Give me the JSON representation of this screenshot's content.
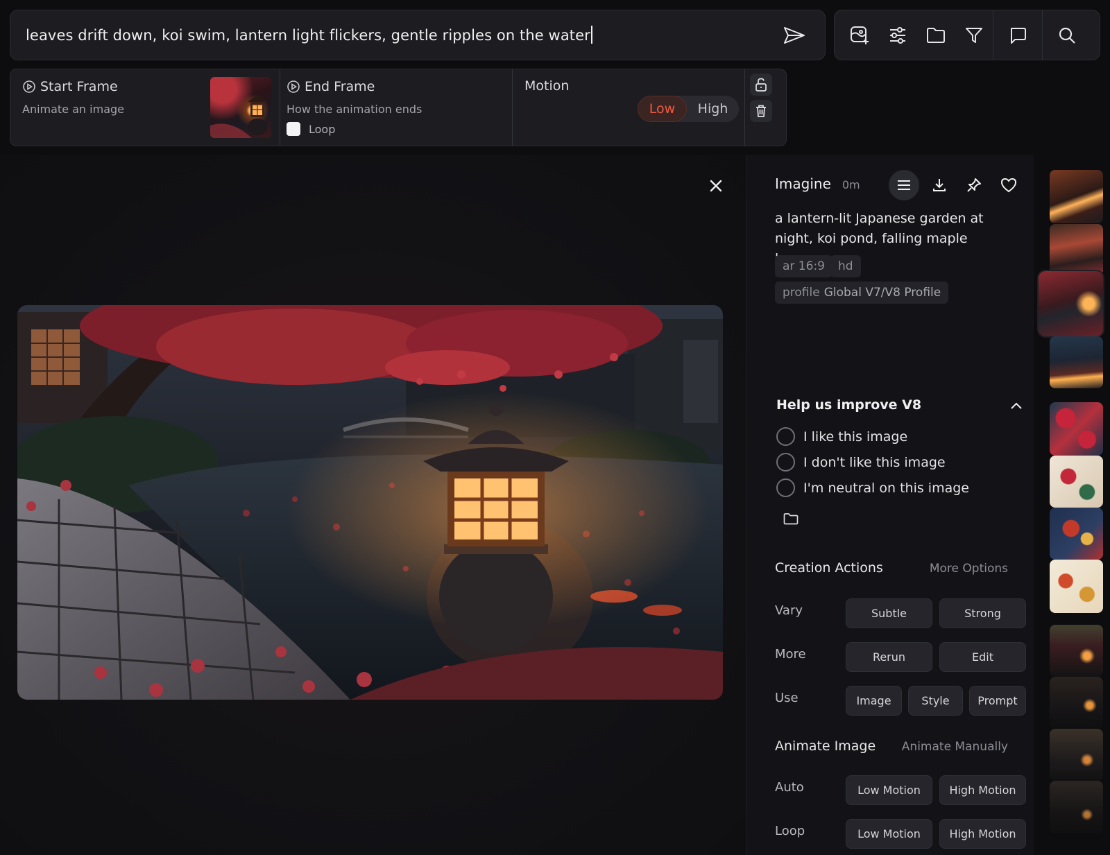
{
  "prompt": {
    "text": "leaves drift down, koi swim, lantern light flickers, gentle ripples on the water"
  },
  "toolbar": {
    "icons": [
      "image-add-icon",
      "sliders-icon",
      "folder-icon",
      "filter-icon",
      "chat-icon",
      "search-icon"
    ]
  },
  "animation_panel": {
    "start_frame": {
      "title": "Start Frame",
      "subtitle": "Animate an image"
    },
    "end_frame": {
      "title": "End Frame",
      "subtitle": "How the animation ends",
      "loop_label": "Loop"
    },
    "motion": {
      "title": "Motion",
      "low": "Low",
      "high": "High",
      "selected": "Low"
    }
  },
  "info": {
    "title": "Imagine",
    "time": "0m",
    "prompt": "a lantern-lit Japanese garden at night, koi pond, falling maple leaves",
    "tags": {
      "ar": "ar 16:9",
      "hd": "hd",
      "profile_key": "profile",
      "profile_value": "Global V7/V8 Profile"
    },
    "help": {
      "title": "Help us improve V8",
      "options": [
        "I like this image",
        "I don't like this image",
        "I'm neutral on this image"
      ]
    },
    "creation": {
      "title": "Creation Actions",
      "more": "More Options",
      "vary": {
        "label": "Vary",
        "subtle": "Subtle",
        "strong": "Strong"
      },
      "more_row": {
        "label": "More",
        "rerun": "Rerun",
        "edit": "Edit"
      },
      "use": {
        "label": "Use",
        "image": "Image",
        "style": "Style",
        "prompt": "Prompt"
      }
    },
    "animate": {
      "title": "Animate Image",
      "manual": "Animate Manually",
      "auto": {
        "label": "Auto",
        "low": "Low Motion",
        "high": "High Motion"
      },
      "loop": {
        "label": "Loop",
        "low": "Low Motion",
        "high": "High Motion"
      }
    }
  },
  "colors": {
    "accent_low": "#f05a45",
    "panel": "#1c1c21",
    "background": "#0d0d10"
  }
}
